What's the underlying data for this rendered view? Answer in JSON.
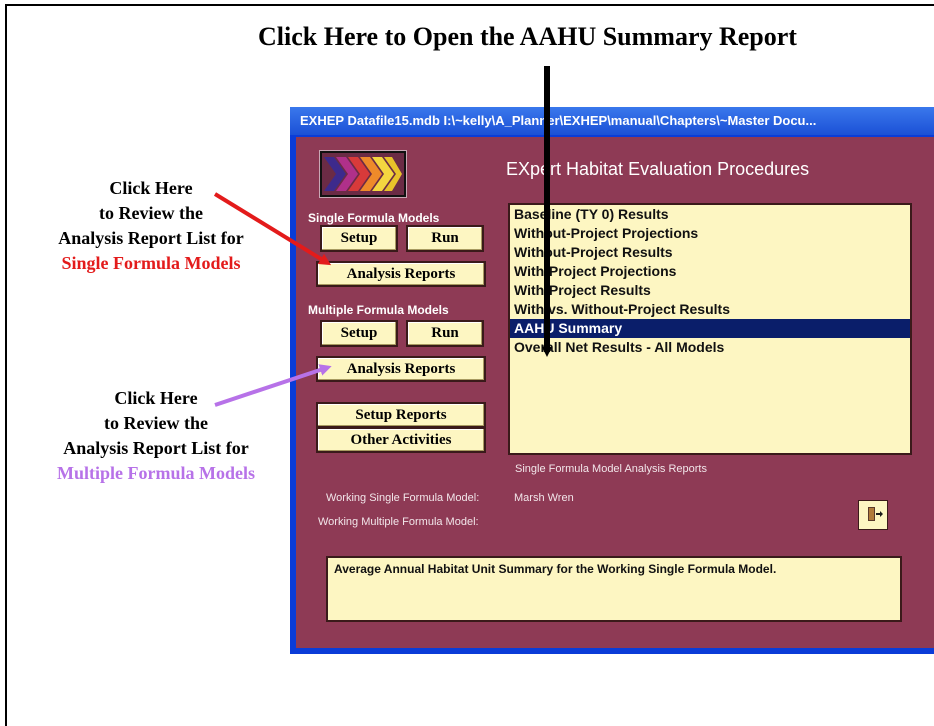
{
  "annotations": {
    "top": "Click Here to Open the AAHU Summary Report",
    "single": {
      "line1": "Click Here",
      "line2": "to Review the",
      "line3": "Analysis Report List for",
      "line4": "Single Formula Models",
      "line4_color": "#e31b1b"
    },
    "multiple": {
      "line1": "Click Here",
      "line2": "to Review the",
      "line3": "Analysis Report List for",
      "line4": "Multiple Formula Models",
      "line4_color": "#b772e8"
    }
  },
  "window": {
    "title": "EXHEP   Datafile15.mdb   I:\\~kelly\\A_Planner\\EXHEP\\manual\\Chapters\\~Master Docu...",
    "app_title": "EXpert Habitat Evaluation Procedures",
    "colors": {
      "client_bg": "#8e3a55",
      "button_bg": "#fdf6c2",
      "selection": "#0a1e6a",
      "titlebar": "#1b50d6"
    }
  },
  "single_group": {
    "label": "Single Formula Models",
    "setup": "Setup",
    "run": "Run",
    "analysis_reports": "Analysis Reports"
  },
  "multiple_group": {
    "label": "Multiple Formula Models",
    "setup": "Setup",
    "run": "Run",
    "analysis_reports": "Analysis Reports"
  },
  "misc_buttons": {
    "setup_reports": "Setup Reports",
    "other_activities": "Other Activities"
  },
  "report_list": {
    "items": [
      "Baseline (TY 0) Results",
      "Without-Project Projections",
      "Without-Project Results",
      "With-Project Projections",
      "With-Project Results",
      "With vs. Without-Project Results",
      "AAHU Summary",
      "Overall Net Results - All Models"
    ],
    "selected_index": 6,
    "caption": "Single Formula Model Analysis Reports"
  },
  "working": {
    "single_label": "Working Single Formula Model:",
    "single_value": "Marsh Wren",
    "multiple_label": "Working Multiple Formula Model:",
    "multiple_value": ""
  },
  "exit_icon": "exit-door-icon",
  "description": "Average Annual Habitat Unit Summary for the Working Single Formula Model."
}
